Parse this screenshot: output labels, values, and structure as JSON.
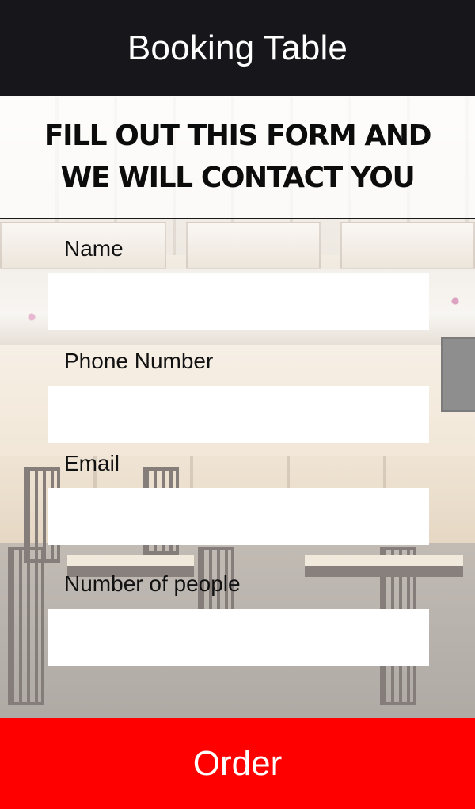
{
  "header": {
    "title": "Booking Table"
  },
  "banner": {
    "heading_line1": "FILL OUT THIS FORM AND",
    "heading_line2": "WE WILL CONTACT YOU"
  },
  "form": {
    "fields": [
      {
        "label": "Name",
        "value": ""
      },
      {
        "label": "Phone Number",
        "value": ""
      },
      {
        "label": "Email",
        "value": ""
      },
      {
        "label": "Number of people",
        "value": ""
      }
    ]
  },
  "order_button": {
    "label": "Order"
  },
  "colors": {
    "header_bg": "#17171b",
    "order_bg": "#fe0000",
    "input_bg": "#ffffff"
  }
}
